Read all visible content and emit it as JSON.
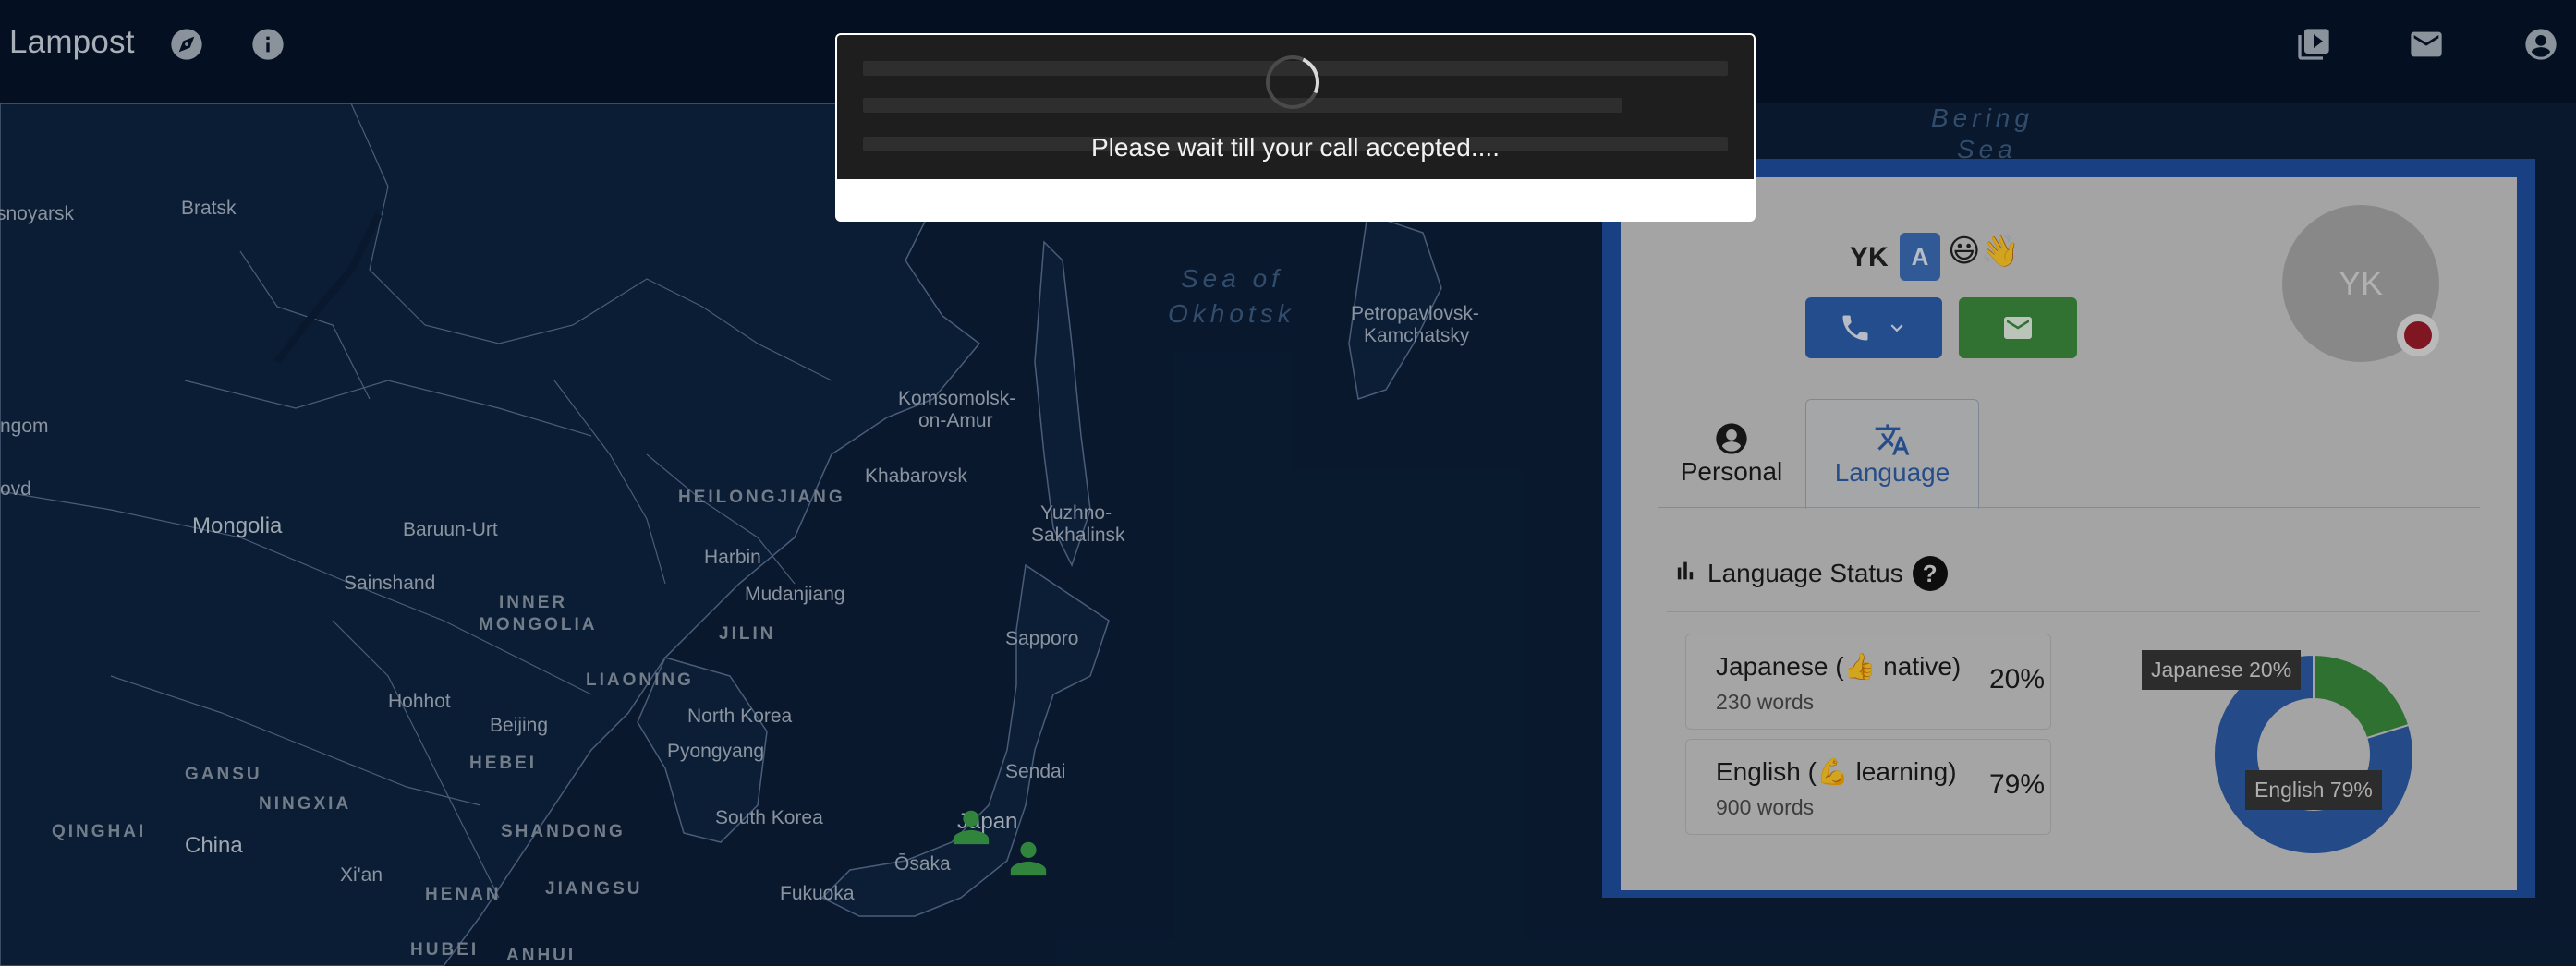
{
  "app": {
    "title": "Lampost"
  },
  "topbar": {
    "icons_left": [
      "compass-icon",
      "info-icon"
    ],
    "icons_right": [
      "video-library-icon",
      "mail-icon",
      "account-icon"
    ]
  },
  "map": {
    "labels": {
      "krasnoyarsk": "snoyarsk",
      "bratsk": "Bratsk",
      "ngom": "ngom",
      "ovd": "ovd",
      "mongolia": "Mongolia",
      "baruun_urt": "Baruun-Urt",
      "sainshand": "Sainshand",
      "inner_mongolia_1": "INNER",
      "inner_mongolia_2": "MONGOLIA",
      "hohhot": "Hohhot",
      "beijing": "Beijing",
      "hebei": "HEBEI",
      "gansu": "GANSU",
      "ningxia": "NINGXIA",
      "qinghai": "QINGHAI",
      "china": "China",
      "xian": "Xi'an",
      "henan": "HENAN",
      "hubei": "HUBEI",
      "anhui": "ANHUI",
      "jiangsu": "JIANGSU",
      "shandong": "SHANDONG",
      "liaoning": "LIAONING",
      "jilin": "JILIN",
      "harbin": "Harbin",
      "mudanjiang": "Mudanjiang",
      "heilongjiang": "HEILONGJIANG",
      "khabarovsk": "Khabarovsk",
      "komsomolsk_1": "Komsomolsk-",
      "komsomolsk_2": "on-Amur",
      "north_korea": "North Korea",
      "pyongyang": "Pyongyang",
      "south_korea": "South Korea",
      "fukuoka": "Fukuoka",
      "osaka": "Ōsaka",
      "japan": "Japan",
      "sendai": "Sendai",
      "sapporo": "Sapporo",
      "yuzhno_1": "Yuzhno-",
      "yuzhno_2": "Sakhalinsk",
      "okhotsk_1": "Sea of",
      "okhotsk_2": "Okhotsk",
      "petropavlovsk_1": "Petropavlovsk-",
      "petropavlovsk_2": "Kamchatsky",
      "bering_1": "Bering",
      "bering_2": "Sea"
    },
    "markers": [
      "user-marker",
      "user-marker"
    ]
  },
  "profile": {
    "name": "YK",
    "badge": "A",
    "emoji": "😃👋",
    "avatar_initials": "YK",
    "tabs": [
      {
        "label": "Personal",
        "icon": "account-circle-icon"
      },
      {
        "label": "Language",
        "icon": "translate-icon"
      }
    ],
    "language_status": {
      "title": "Language Status",
      "help": "?",
      "languages": [
        {
          "name": "Japanese (👍 native)",
          "words": "230 words",
          "percent": "20%"
        },
        {
          "name": "English (💪 learning)",
          "words": "900 words",
          "percent": "79%"
        }
      ]
    }
  },
  "chart_data": {
    "type": "pie",
    "categories": [
      "Japanese",
      "English"
    ],
    "values": [
      20,
      79
    ],
    "labels": [
      "Japanese 20%",
      "English 79%"
    ],
    "colors": [
      "#3a8a3c",
      "#2c5ba5"
    ]
  },
  "modal": {
    "message": "Please wait till your call accepted...."
  },
  "colors": {
    "background": "#0b1e38",
    "topbar": "#06142a",
    "panel_border": "#1f4fa0",
    "call_button": "#2b5fad",
    "mail_button": "#3c8c3f"
  }
}
